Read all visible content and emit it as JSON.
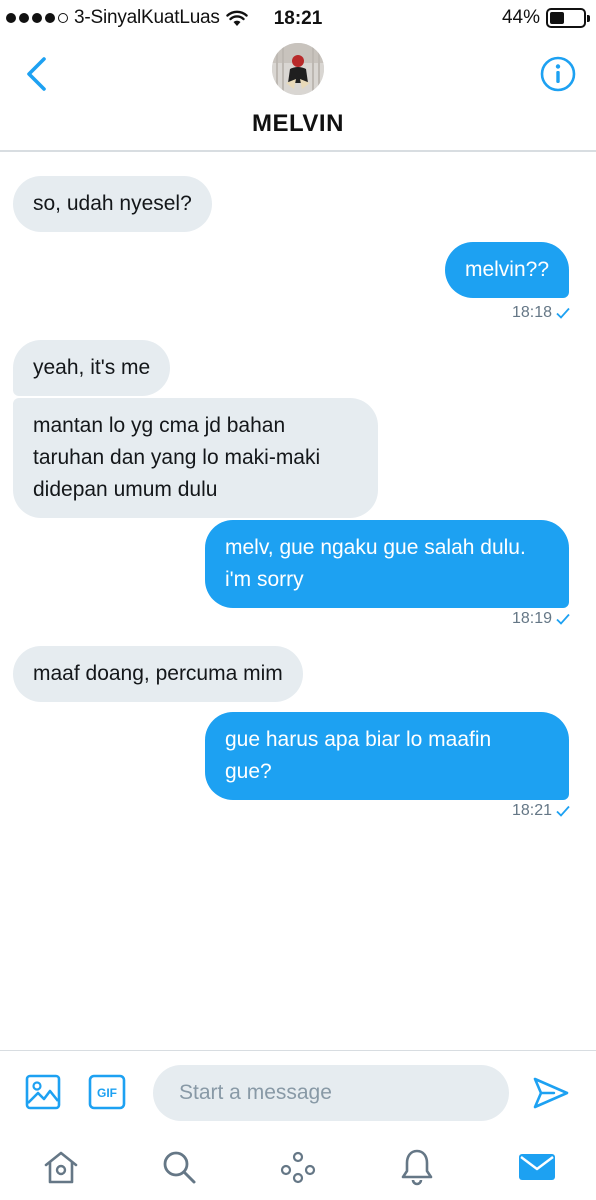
{
  "status_bar": {
    "carrier": "3-SinyalKuatLuas",
    "time": "18:21",
    "battery": "44%",
    "battery_level": 0.44
  },
  "header": {
    "contact_name": "MELVIN"
  },
  "messages": [
    {
      "direction": "in",
      "lines": [
        "so, udah nyesel?"
      ]
    },
    {
      "direction": "out",
      "lines": [
        "melvin??"
      ],
      "time": "18:18"
    },
    {
      "direction": "in",
      "lines": [
        "yeah, it's me"
      ]
    },
    {
      "direction": "in",
      "lines": [
        "mantan lo yg cma jd bahan",
        "taruhan dan yang lo maki-maki",
        "didepan umum dulu"
      ]
    },
    {
      "direction": "out",
      "lines": [
        "melv, gue ngaku gue salah dulu.",
        "i'm sorry"
      ],
      "time": "18:19"
    },
    {
      "direction": "in",
      "lines": [
        "maaf doang, percuma mim"
      ]
    },
    {
      "direction": "out",
      "lines": [
        "gue harus apa biar lo maafin",
        "gue?"
      ],
      "time": "18:21"
    }
  ],
  "composer": {
    "placeholder": "Start a message",
    "gif_label": "GIF"
  },
  "tabs": [
    {
      "name": "home",
      "icon": "home-icon"
    },
    {
      "name": "search",
      "icon": "search-icon"
    },
    {
      "name": "moments",
      "icon": "moments-icon"
    },
    {
      "name": "notifications",
      "icon": "bell-icon"
    },
    {
      "name": "messages",
      "icon": "envelope-icon",
      "active": true
    }
  ],
  "colors": {
    "accent": "#1da1f2",
    "incoming_bubble": "#e6ecf0",
    "muted_text": "#657786"
  }
}
